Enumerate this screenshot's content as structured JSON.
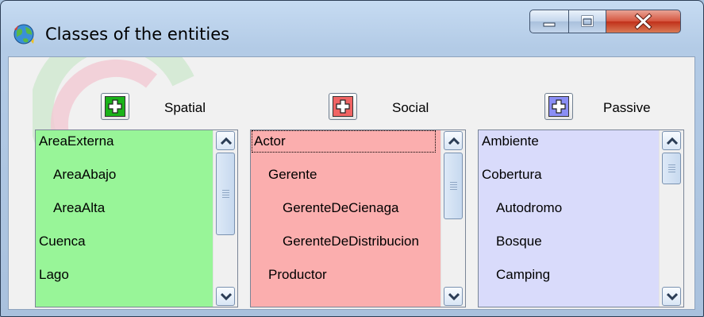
{
  "window": {
    "title": "Classes of the entities"
  },
  "icons": {
    "app": "globe-icon",
    "minimize": "minimize-icon",
    "maximize": "maximize-icon",
    "close": "close-icon",
    "add": "plus-icon"
  },
  "columns": [
    {
      "label": "Spatial",
      "color": "#98f598",
      "button_color": "#1ab31a",
      "items": [
        "AreaExterna",
        "AreaAbajo",
        "AreaAlta",
        "Cuenca",
        "Lago"
      ],
      "indent": [
        0,
        1,
        1,
        0,
        0
      ]
    },
    {
      "label": "Social",
      "color": "#fbaeae",
      "button_color": "#f06464",
      "items": [
        "Actor",
        "Gerente",
        "GerenteDeCienaga",
        "GerenteDeDistribucion",
        "Productor"
      ],
      "indent": [
        0,
        1,
        2,
        2,
        1
      ],
      "selected": "Actor"
    },
    {
      "label": "Passive",
      "color": "#d9dbfb",
      "button_color": "#8a8ef5",
      "items": [
        "Ambiente",
        "Cobertura",
        "Autodromo",
        "Bosque",
        "Camping"
      ],
      "indent": [
        0,
        0,
        1,
        1,
        1
      ]
    }
  ]
}
